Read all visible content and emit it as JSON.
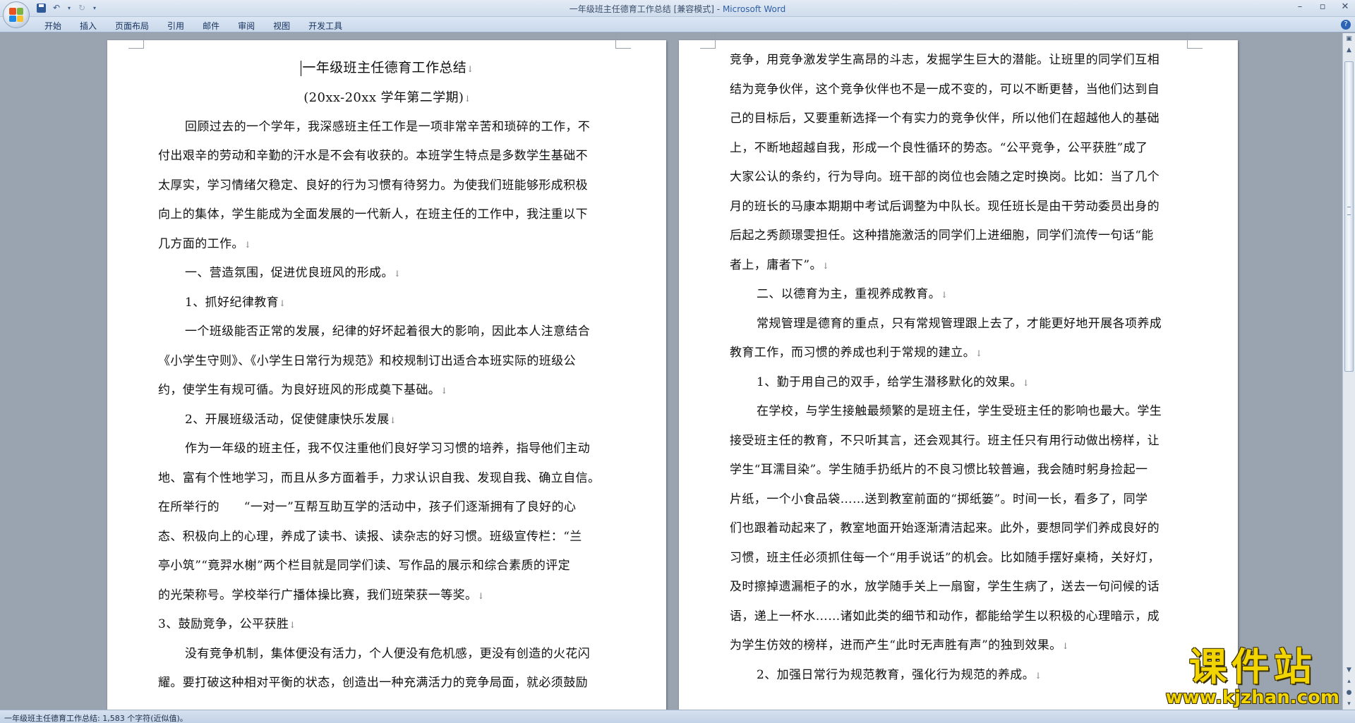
{
  "window": {
    "title_doc": "一年级班主任德育工作总结 [兼容模式]",
    "title_sep": " - ",
    "title_app": "Microsoft Word"
  },
  "ribbon": {
    "tabs": [
      "开始",
      "插入",
      "页面布局",
      "引用",
      "邮件",
      "审阅",
      "视图",
      "开发工具"
    ]
  },
  "page1": {
    "title": "一年级班主任德育工作总结",
    "subtitle": "(20xx-20xx 学年第二学期)",
    "lines": [
      {
        "t": "回顾过去的一个学年，我深感班主任工作是一项非常辛苦和琐碎的工作，不",
        "indent": true
      },
      {
        "t": "付出艰辛的劳动和辛勤的汗水是不会有收获的。本班学生特点是多数学生基础不",
        "indent": false
      },
      {
        "t": "太厚实，学习情绪欠稳定、良好的行为习惯有待努力。为使我们班能够形成积极",
        "indent": false
      },
      {
        "t": "向上的集体，学生能成为全面发展的一代新人，在班主任的工作中，我注重以下",
        "indent": false
      },
      {
        "t": "几方面的工作。",
        "indent": false,
        "mark": true
      },
      {
        "t": "一、营造氛围，促进优良班风的形成。",
        "indent": true,
        "mark": true
      },
      {
        "t": "1、抓好纪律教育",
        "indent": true,
        "mark": true
      },
      {
        "t": "一个班级能否正常的发展，纪律的好坏起着很大的影响，因此本人注意结合",
        "indent": true
      },
      {
        "t": "《小学生守则》、《小学生日常行为规范》和校规制订出适合本班实际的班级公",
        "indent": false
      },
      {
        "t": "约，使学生有规可循。为良好班风的形成奠下基础。",
        "indent": false,
        "mark": true
      },
      {
        "t": "2、开展班级活动，促使健康快乐发展",
        "indent": true,
        "mark": true
      },
      {
        "t": "作为一年级的班主任，我不仅注重他们良好学习习惯的培养，指导他们主动",
        "indent": true
      },
      {
        "t": "地、富有个性地学习，而且从多方面着手，力求认识自我、发现自我、确立自信。",
        "indent": false
      },
      {
        "t": "在所举行的　　“一对一”互帮互助互学的活动中，孩子们逐渐拥有了良好的心",
        "indent": false
      },
      {
        "t": "态、积极向上的心理，养成了读书、读报、读杂志的好习惯。班级宣传栏：“兰",
        "indent": false
      },
      {
        "t": "亭小筑”“竟羿水榭”两个栏目就是同学们读、写作品的展示和综合素质的评定",
        "indent": false
      },
      {
        "t": "的光荣称号。学校举行广播体操比赛，我们班荣获一等奖。",
        "indent": false,
        "mark": true
      },
      {
        "t": "3、鼓励竞争，公平获胜",
        "indent": false,
        "mark": true
      },
      {
        "t": "没有竞争机制，集体便没有活力，个人便没有危机感，更没有创造的火花闪",
        "indent": true
      },
      {
        "t": "耀。要打破这种相对平衡的状态，创造出一种充满活力的竞争局面，就必须鼓励",
        "indent": false
      }
    ]
  },
  "page2": {
    "lines": [
      {
        "t": "竞争，用竞争激发学生高昂的斗志，发掘学生巨大的潜能。让班里的同学们互相",
        "indent": false
      },
      {
        "t": "结为竞争伙伴，这个竞争伙伴也不是一成不变的，可以不断更替，当他们达到自",
        "indent": false
      },
      {
        "t": "己的目标后，又要重新选择一个有实力的竞争伙伴，所以他们在超越他人的基础",
        "indent": false
      },
      {
        "t": "上，不断地超越自我，形成一个良性循环的势态。“公平竞争，公平获胜”成了",
        "indent": false
      },
      {
        "t": "大家公认的条约，行为导向。班干部的岗位也会随之定时换岗。比如：当了几个",
        "indent": false
      },
      {
        "t": "月的班长的马康本期期中考试后调整为中队长。现任班长是由干劳动委员出身的",
        "indent": false
      },
      {
        "t": "后起之秀颜璟雯担任。这种措施激活的同学们上进细胞，同学们流传一句话“能",
        "indent": false
      },
      {
        "t": "者上，庸者下”。",
        "indent": false,
        "mark": true
      },
      {
        "t": "二、以德育为主，重视养成教育。",
        "indent": true,
        "mark": true
      },
      {
        "t": "常规管理是德育的重点，只有常规管理跟上去了，才能更好地开展各项养成",
        "indent": true
      },
      {
        "t": "教育工作，而习惯的养成也利于常规的建立。",
        "indent": false,
        "mark": true
      },
      {
        "t": "1、勤于用自己的双手，给学生潜移默化的效果。",
        "indent": true,
        "mark": true
      },
      {
        "t": "在学校，与学生接触最频繁的是班主任，学生受班主任的影响也最大。学生",
        "indent": true
      },
      {
        "t": "接受班主任的教育，不只听其言，还会观其行。班主任只有用行动做出榜样，让",
        "indent": false
      },
      {
        "t": "学生“耳濡目染”。学生随手扔纸片的不良习惯比较普遍，我会随时躬身捡起一",
        "indent": false
      },
      {
        "t": "片纸，一个小食品袋……送到教室前面的“掷纸篓”。时间一长，看多了，同学",
        "indent": false
      },
      {
        "t": "们也跟着动起来了，教室地面开始逐渐清洁起来。此外，要想同学们养成良好的",
        "indent": false
      },
      {
        "t": "习惯，班主任必须抓住每一个“用手说话”的机会。比如随手摆好桌椅，关好灯，",
        "indent": false
      },
      {
        "t": "及时擦掉遗漏柜子的水，放学随手关上一扇窗，学生生病了，送去一句问候的话",
        "indent": false
      },
      {
        "t": "语，递上一杯水……诸如此类的细节和动作，都能给学生以积极的心理暗示，成",
        "indent": false
      },
      {
        "t": "为学生仿效的榜样，进而产生“此时无声胜有声”的独到效果。",
        "indent": false,
        "mark": true
      },
      {
        "t": "2、加强日常行为规范教育，强化行为规范的养成。",
        "indent": true,
        "mark": true
      }
    ]
  },
  "status": {
    "text": "一年级班主任德育工作总结: 1,583 个字符(近似值)。"
  },
  "watermark": {
    "main": "课件站",
    "url": "www.kjzhan.com"
  },
  "paragraph_mark": "↓",
  "colors": {
    "title_app": "#2d5fa4",
    "watermark": "#f2d400",
    "workspace": "#9aa4b1"
  }
}
